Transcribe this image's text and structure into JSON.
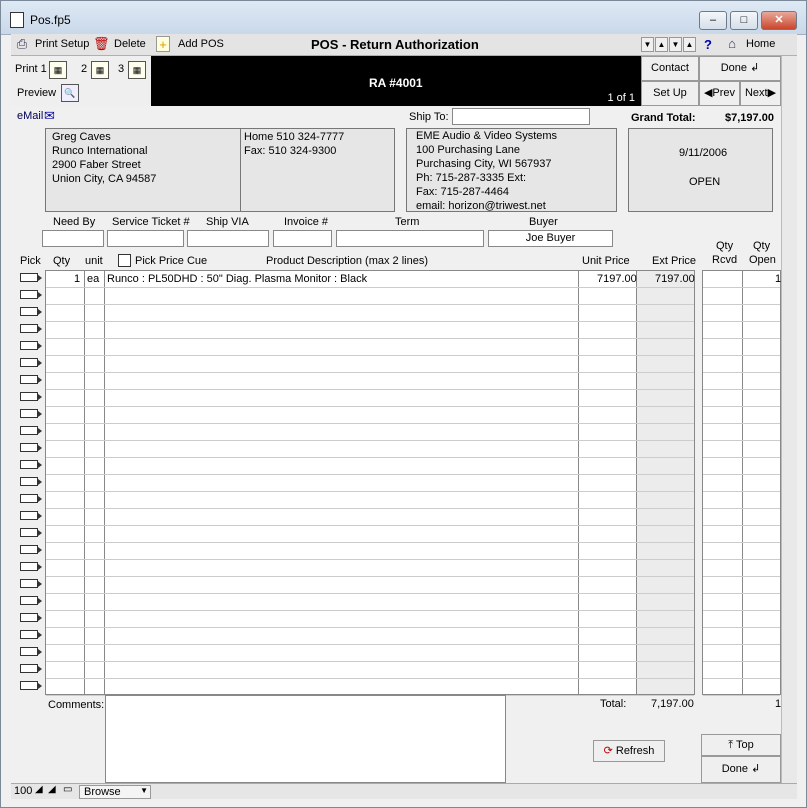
{
  "window": {
    "title": "Pos.fp5",
    "min": "–",
    "max": "□",
    "close": "✕"
  },
  "toolbar": {
    "print_setup": "Print Setup",
    "delete": "Delete",
    "add_pos": "Add POS",
    "title": "POS - Return Authorization",
    "home": "Home",
    "help": "?"
  },
  "print": {
    "label": "Print 1",
    "two": "2",
    "three": "3",
    "preview": "Preview"
  },
  "header": {
    "ra_number": "RA #4001",
    "page": "1 of 1"
  },
  "nav": {
    "contact": "Contact",
    "done": "Done",
    "setup": "Set Up",
    "prev": "Prev",
    "next": "Next"
  },
  "email_label": "eMail",
  "ship_to_label": "Ship To:",
  "grand_total_label": "Grand Total:",
  "grand_total": "$7,197.00",
  "customer": {
    "name": "Greg Caves",
    "company": "Runco International",
    "street": "2900 Faber Street",
    "city": "Union City, CA 94587",
    "home": "Home 510 324-7777",
    "fax": "Fax: 510 324-9300"
  },
  "vendor": {
    "name": "EME Audio & Video Systems",
    "street": "100 Purchasing Lane",
    "city": "Purchasing City, WI 567937",
    "ph": "Ph: 715-287-3335 Ext:",
    "fax": "Fax: 715-287-4464",
    "email": "email: horizon@triwest.net"
  },
  "status": {
    "date": "9/11/2006",
    "state": "OPEN"
  },
  "fields": {
    "need_by": "Need By",
    "service_ticket": "Service Ticket #",
    "ship_via": "Ship VIA",
    "invoice": "Invoice #",
    "term": "Term",
    "buyer": "Buyer",
    "buyer_value": "Joe Buyer"
  },
  "columns": {
    "pick": "Pick",
    "qty": "Qty",
    "unit": "unit",
    "pick_price_cue": "Pick Price Cue",
    "description": "Product Description (max 2 lines)",
    "unit_price": "Unit Price",
    "ext_price": "Ext Price",
    "qty_rcvd_1": "Qty",
    "qty_rcvd_2": "Rcvd",
    "qty_open_1": "Qty",
    "qty_open_2": "Open"
  },
  "line_items": [
    {
      "qty": "1",
      "unit": "ea",
      "description": "Runco : PL50DHD : 50\" Diag. Plasma Monitor : Black",
      "unit_price": "7197.00",
      "ext_price": "7197.00",
      "qty_open": "1"
    }
  ],
  "footer": {
    "comments": "Comments:",
    "total_label": "Total:",
    "total": "7,197.00",
    "open_total": "1",
    "refresh": "Refresh",
    "top": "Top",
    "done": "Done"
  },
  "statusbar": {
    "zoom": "100",
    "mode": "Browse"
  }
}
